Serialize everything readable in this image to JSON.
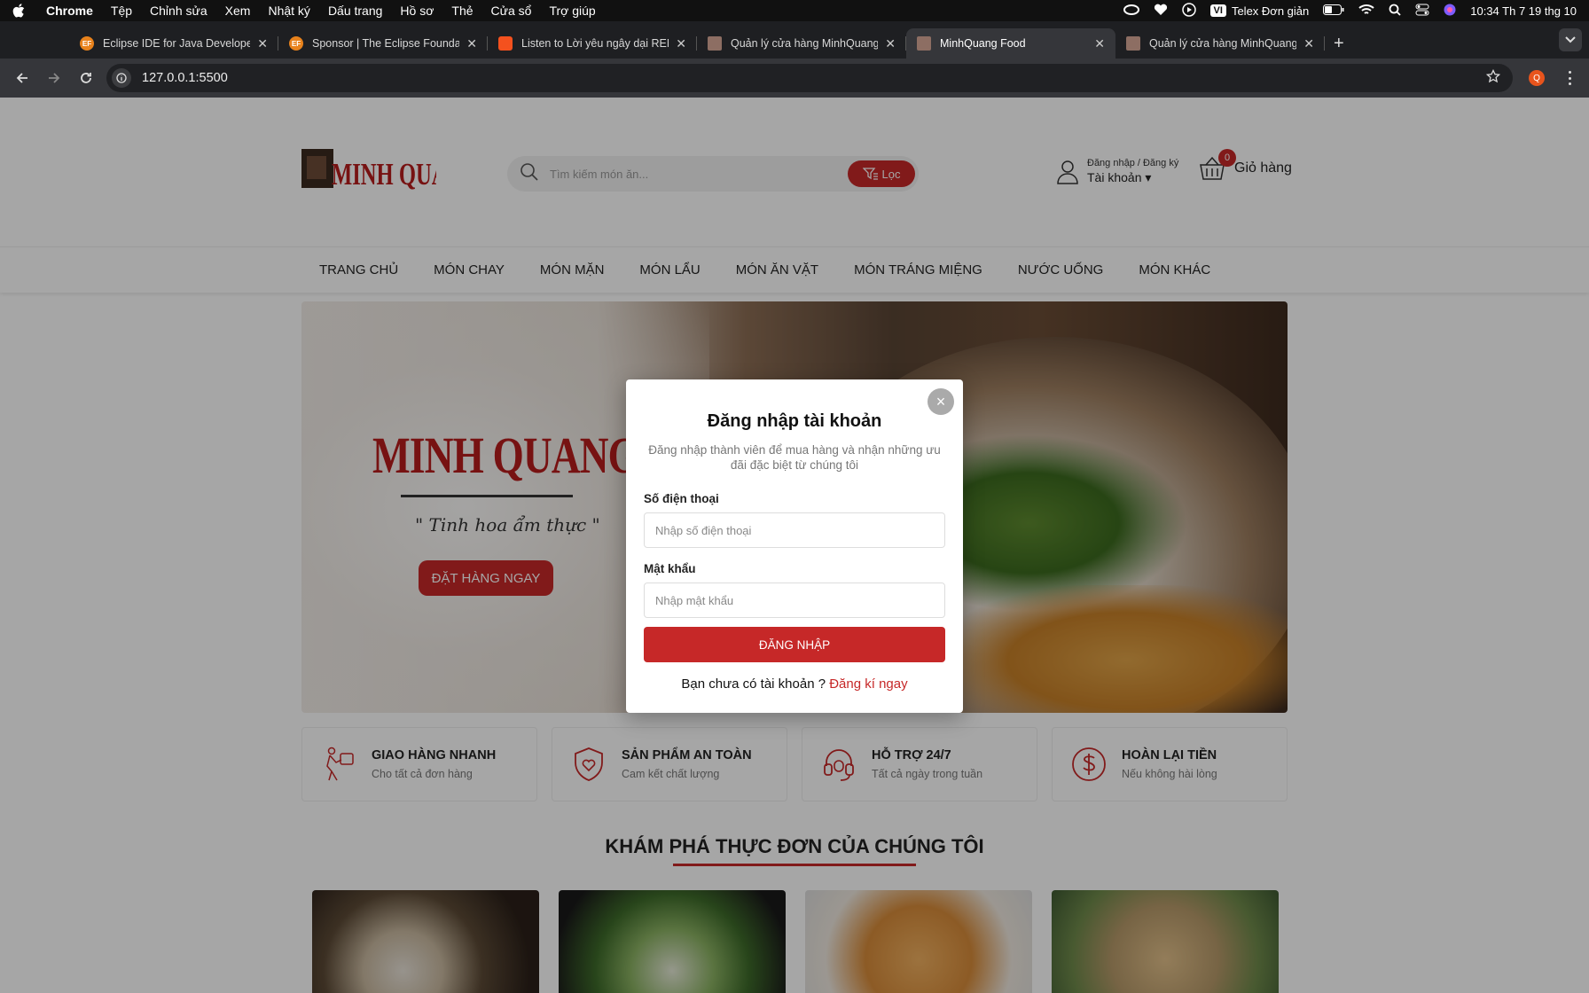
{
  "os_menu": {
    "app": "Chrome",
    "items": [
      "Tệp",
      "Chỉnh sửa",
      "Xem",
      "Nhật ký",
      "Dấu trang",
      "Hồ sơ",
      "Thẻ",
      "Cửa sổ",
      "Trợ giúp"
    ],
    "input_badge": "VI",
    "input_method": "Telex Đơn giản",
    "clock": "10:34 Th 7 19 thg 10"
  },
  "tabs": [
    {
      "title": "Eclipse IDE for Java Develope",
      "favicon": "EF",
      "color": "#e8821c",
      "active": false
    },
    {
      "title": "Sponsor | The Eclipse Founda",
      "favicon": "EF",
      "color": "#e8821c",
      "active": false
    },
    {
      "title": "Listen to Lời yêu ngây dại REN",
      "favicon": "",
      "color": "#f4511e",
      "active": false
    },
    {
      "title": "Quản lý cửa hàng MinhQuang",
      "favicon": "",
      "color": "#8d6e63",
      "active": false
    },
    {
      "title": "MinhQuang Food",
      "favicon": "",
      "color": "#8d6e63",
      "active": true
    },
    {
      "title": "Quản lý cửa hàng MinhQuang",
      "favicon": "",
      "color": "#8d6e63",
      "active": false
    }
  ],
  "address": {
    "url": "127.0.0.1:5500",
    "profile_initial": "Q"
  },
  "header": {
    "logo_text": "MINH QUANG FOOD",
    "search_placeholder": "Tìm kiếm món ăn...",
    "filter_label": "Lọc",
    "account_sub": "Đăng nhập / Đăng ký",
    "account_main": "Tài khoản",
    "cart_count": "0",
    "cart_label": "Giỏ hàng"
  },
  "nav": [
    "TRANG CHỦ",
    "MÓN CHAY",
    "MÓN MẶN",
    "MÓN LẨU",
    "MÓN ĂN VẶT",
    "MÓN TRÁNG MIỆNG",
    "NƯỚC UỐNG",
    "MÓN KHÁC"
  ],
  "hero": {
    "brand": "MINH QUANG FOOD",
    "slogan": "\" Tinh hoa ẩm thực \"",
    "cta": "ĐẶT HÀNG NGAY"
  },
  "features": [
    {
      "title": "GIAO HÀNG NHANH",
      "sub": "Cho tất cả đơn hàng",
      "icon": "delivery-icon"
    },
    {
      "title": "SẢN PHẨM AN TOÀN",
      "sub": "Cam kết chất lượng",
      "icon": "shield-heart-icon"
    },
    {
      "title": "HỖ TRỢ 24/7",
      "sub": "Tất cả ngày trong tuần",
      "icon": "headset-icon"
    },
    {
      "title": "HOÀN LẠI TIỀN",
      "sub": "Nếu không hài lòng",
      "icon": "dollar-icon"
    }
  ],
  "section_title": "KHÁM PHÁ THỰC ĐƠN CỦA CHÚNG TÔI",
  "modal": {
    "title": "Đăng nhập tài khoản",
    "desc": "Đăng nhập thành viên để mua hàng và nhận những ưu đãi đặc biệt từ chúng tôi",
    "phone_label": "Số điện thoại",
    "phone_placeholder": "Nhập số điện thoại",
    "pass_label": "Mật khẩu",
    "pass_placeholder": "Nhập mật khẩu",
    "submit": "ĐĂNG NHẬP",
    "no_account": "Bạn chưa có tài khoản ?",
    "register": "Đăng kí ngay",
    "close": "×"
  },
  "colors": {
    "accent": "#c62828"
  }
}
